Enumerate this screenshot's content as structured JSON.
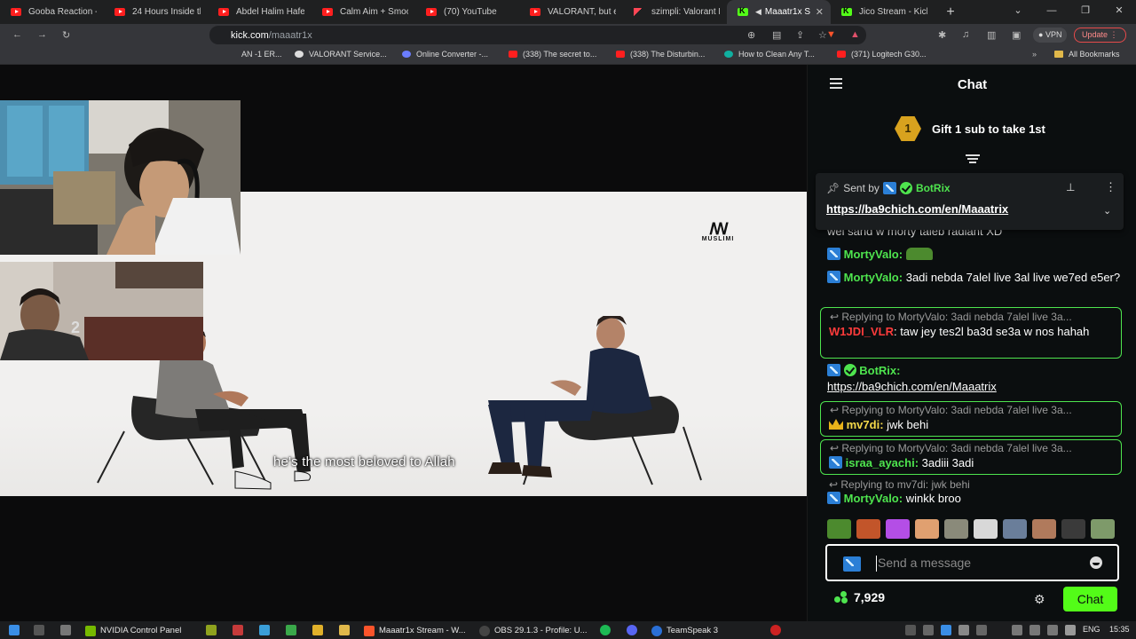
{
  "browser": {
    "tabs": [
      {
        "title": "Gooba Reaction -",
        "icon": "youtube-icon"
      },
      {
        "title": "24 Hours Inside th",
        "icon": "youtube-icon"
      },
      {
        "title": "Abdel Halim Hafez",
        "icon": "youtube-icon"
      },
      {
        "title": "Calm Aim + Smoo",
        "icon": "youtube-icon"
      },
      {
        "title": "(70) YouTube",
        "icon": "youtube-icon"
      },
      {
        "title": "VALORANT, but ev",
        "icon": "youtube-icon"
      },
      {
        "title": "szimpli: Valorant P",
        "icon": "valorant-icon"
      },
      {
        "title": "Maaatr1x S",
        "icon": "kick-icon",
        "active": true
      },
      {
        "title": "Jico Stream - Kick",
        "icon": "kick-icon"
      }
    ],
    "url_host": "kick.com",
    "url_path": "/maaatr1x",
    "vpn_label": "VPN",
    "update_label": "Update",
    "bookmarks": [
      {
        "label": "AN -1 ER..."
      },
      {
        "label": "VALORANT Service..."
      },
      {
        "label": "Online Converter -..."
      },
      {
        "label": "(338) The secret to..."
      },
      {
        "label": "(338) The Disturbin..."
      },
      {
        "label": "How to Clean Any T..."
      },
      {
        "label": "(371) Logitech G30..."
      },
      {
        "label": "All Bookmarks"
      }
    ]
  },
  "stream": {
    "subtitle": "he's the most beloved to Allah",
    "logo_text": "MUSLIMI"
  },
  "chat": {
    "title": "Chat",
    "gift_rank": "1",
    "gift_text": "Gift 1 sub to take 1st",
    "pinned": {
      "sent_by": "Sent by",
      "user": "BotRix",
      "link": "https://ba9chich.com/en/Maaatrix"
    },
    "partial_line": "wel sand w morty taleb radiant XD",
    "messages": {
      "m1_user": "MortyValo:",
      "m2_user": "MortyValo:",
      "m2_text": "3adi nebda 7alel live 3al live we7ed e5er?",
      "r1_reply": "Replying to MortyValo: 3adi nebda 7alel live 3a...",
      "r1_user": "W1JDI_VLR",
      "r1_text": ": taw jey tes2l ba3d se3a w nos hahah",
      "b_user": "BotRix:",
      "b_link": "https://ba9chich.com/en/Maaatrix",
      "r2_reply": "Replying to MortyValo: 3adi nebda 7alel live 3a...",
      "r2_user": "mv7di:",
      "r2_text": "jwk behi",
      "r3_reply": "Replying to MortyValo: 3adi nebda 7alel live 3a...",
      "r3_user": "israa_ayachi:",
      "r3_text": "3adiii 3adi",
      "r4_reply": "Replying to mv7di: jwk behi",
      "r4_user": "MortyValo:",
      "r4_text": "winkk broo"
    },
    "input_placeholder": "Send a message",
    "points": "7,929",
    "send_label": "Chat"
  },
  "taskbar": {
    "items": [
      {
        "label": "NVIDIA Control Panel"
      },
      {
        "label": "Maaatr1x Stream - W..."
      },
      {
        "label": "OBS 29.1.3 - Profile: U..."
      },
      {
        "label": "TeamSpeak 3"
      }
    ],
    "language": "ENG",
    "clock": "15:35"
  },
  "colors": {
    "kick_green": "#53fc18",
    "chat_bg": "#0b0e0f",
    "reply_border": "#4ee44e"
  }
}
